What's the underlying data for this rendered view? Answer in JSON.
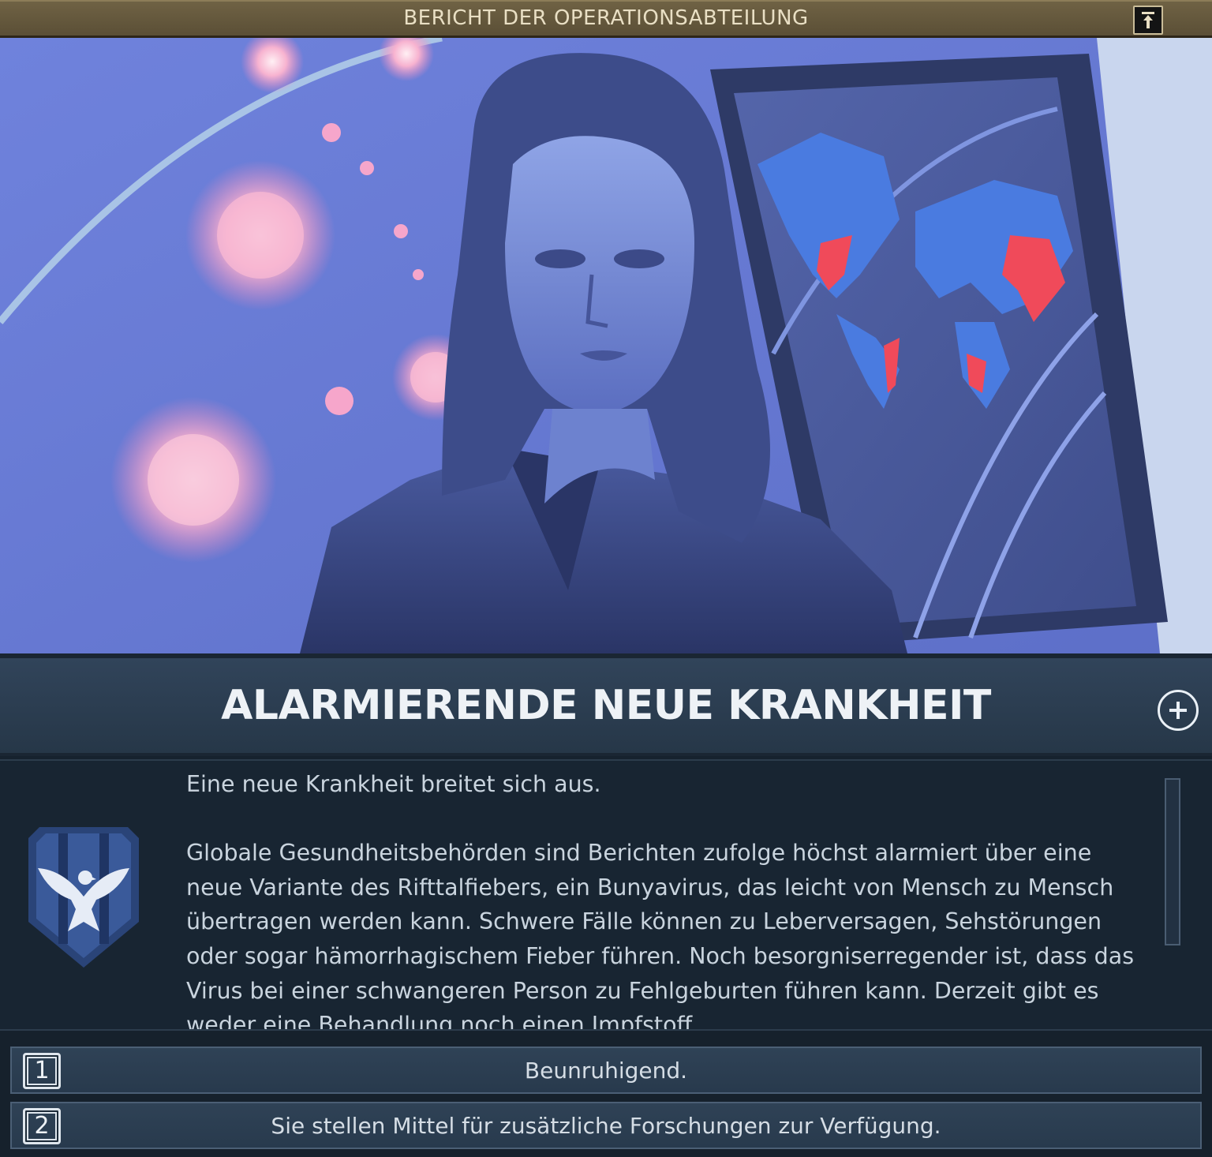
{
  "header": {
    "title": "BERICHT DER OPERATIONSABTEILUNG",
    "collapse_icon": "arrow-up-to-bar-icon"
  },
  "event": {
    "title": "ALARMIERENDE NEUE KRANKHEIT",
    "expand_icon": "plus-circle-icon",
    "paragraphs": [
      "Eine neue Krankheit breitet sich aus.",
      "Globale Gesundheitsbehörden sind Berichten zufolge höchst alarmiert über eine neue Variante des Rifttalfiebers, ein Bunyavirus, das leicht von Mensch zu Mensch übertragen werden kann. Schwere Fälle können zu Leberversagen, Sehstörungen oder sogar hämorrhagischem Fieber führen. Noch besorgniserregender ist, dass das Virus bei einer schwangeren Person zu Fehlgeburten führen kann. Derzeit gibt es weder eine Behandlung noch einen Impfstoff."
    ],
    "emblem_icon": "eagle-shield-icon"
  },
  "options": [
    {
      "key": "1",
      "label": "Beunruhigend."
    },
    {
      "key": "2",
      "label": "Sie stellen Mittel für zusätzliche Forschungen zur Verfügung."
    }
  ],
  "colors": {
    "header_bg": "#6f6244",
    "header_text": "#e9dfc4",
    "panel_bg": "#182532",
    "title_band": "#31445a",
    "illustration_bg": "#6b7fd8",
    "virus_pink": "#f4a0c8",
    "outbreak_red": "#f04a5a"
  }
}
